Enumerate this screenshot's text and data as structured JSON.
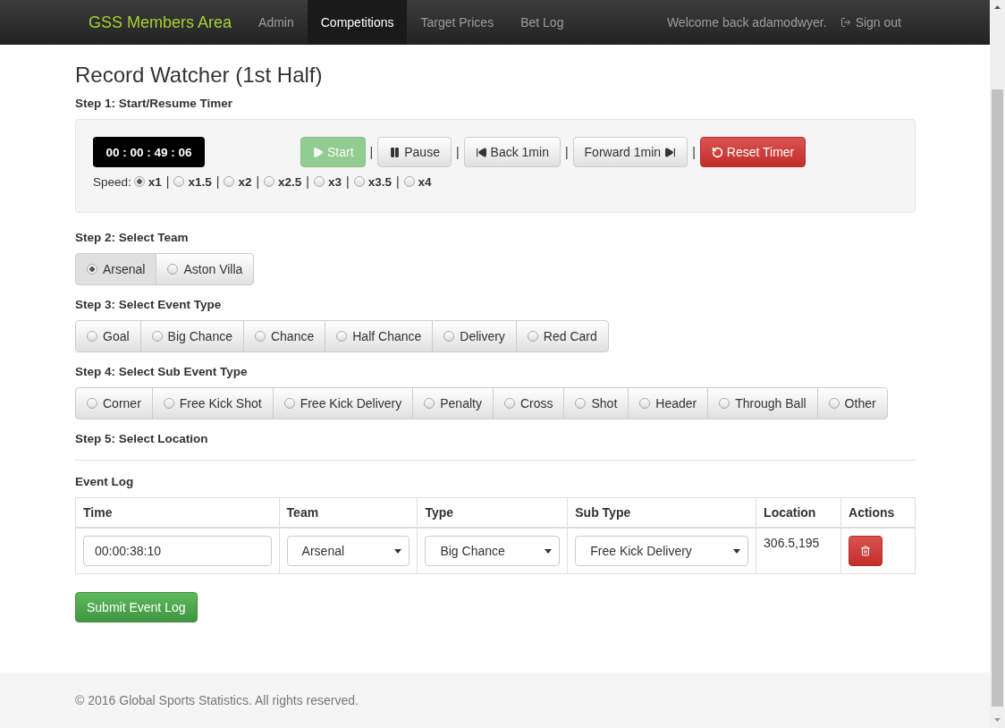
{
  "navbar": {
    "brand": "GSS Members Area",
    "items": [
      {
        "label": "Admin",
        "selected": false
      },
      {
        "label": "Competitions",
        "selected": true
      },
      {
        "label": "Target Prices",
        "selected": false
      },
      {
        "label": "Bet Log",
        "selected": false
      }
    ],
    "welcome": "Welcome back adamodwyer.",
    "sign_out": "Sign out"
  },
  "title": "Record Watcher (1st Half)",
  "step1": {
    "label": "Step 1: Start/Resume Timer",
    "timer": "00 : 00 : 49 : 06",
    "separator": "|",
    "buttons": [
      {
        "kind": "start",
        "label": "Start",
        "disabled": true
      },
      {
        "kind": "pause",
        "label": "Pause",
        "disabled": false
      },
      {
        "kind": "back",
        "label": "Back 1min",
        "disabled": false
      },
      {
        "kind": "forward",
        "label": "Forward 1min",
        "disabled": false
      },
      {
        "kind": "reset",
        "label": "Reset Timer",
        "disabled": false
      }
    ],
    "speed_label": "Speed:",
    "speeds": [
      {
        "label": "x1",
        "selected": true
      },
      {
        "label": "x1.5",
        "selected": false
      },
      {
        "label": "x2",
        "selected": false
      },
      {
        "label": "x2.5",
        "selected": false
      },
      {
        "label": "x3",
        "selected": false
      },
      {
        "label": "x3.5",
        "selected": false
      },
      {
        "label": "x4",
        "selected": false
      }
    ]
  },
  "step2": {
    "label": "Step 2: Select Team",
    "options": [
      {
        "label": "Arsenal",
        "selected": true
      },
      {
        "label": "Aston Villa",
        "selected": false
      }
    ]
  },
  "step3": {
    "label": "Step 3: Select Event Type",
    "options": [
      {
        "label": "Goal",
        "selected": false
      },
      {
        "label": "Big Chance",
        "selected": false
      },
      {
        "label": "Chance",
        "selected": false
      },
      {
        "label": "Half Chance",
        "selected": false
      },
      {
        "label": "Delivery",
        "selected": false
      },
      {
        "label": "Red Card",
        "selected": false
      }
    ]
  },
  "step4": {
    "label": "Step 4: Select Sub Event Type",
    "options": [
      {
        "label": "Corner",
        "selected": false
      },
      {
        "label": "Free Kick Shot",
        "selected": false
      },
      {
        "label": "Free Kick Delivery",
        "selected": false
      },
      {
        "label": "Penalty",
        "selected": false
      },
      {
        "label": "Cross",
        "selected": false
      },
      {
        "label": "Shot",
        "selected": false
      },
      {
        "label": "Header",
        "selected": false
      },
      {
        "label": "Through Ball",
        "selected": false
      },
      {
        "label": "Other",
        "selected": false
      }
    ]
  },
  "step5": {
    "label": "Step 5: Select Location"
  },
  "event_log": {
    "label": "Event Log",
    "columns": [
      "Time",
      "Team",
      "Type",
      "Sub Type",
      "Location",
      "Actions"
    ],
    "rows": [
      {
        "time": "00:00:38:10",
        "team": "Arsenal",
        "type": "Big Chance",
        "sub_type": "Free Kick Delivery",
        "location": "306.5,195"
      }
    ]
  },
  "submit": "Submit Event Log",
  "footer": "© 2016 Global Sports Statistics. All rights reserved."
}
